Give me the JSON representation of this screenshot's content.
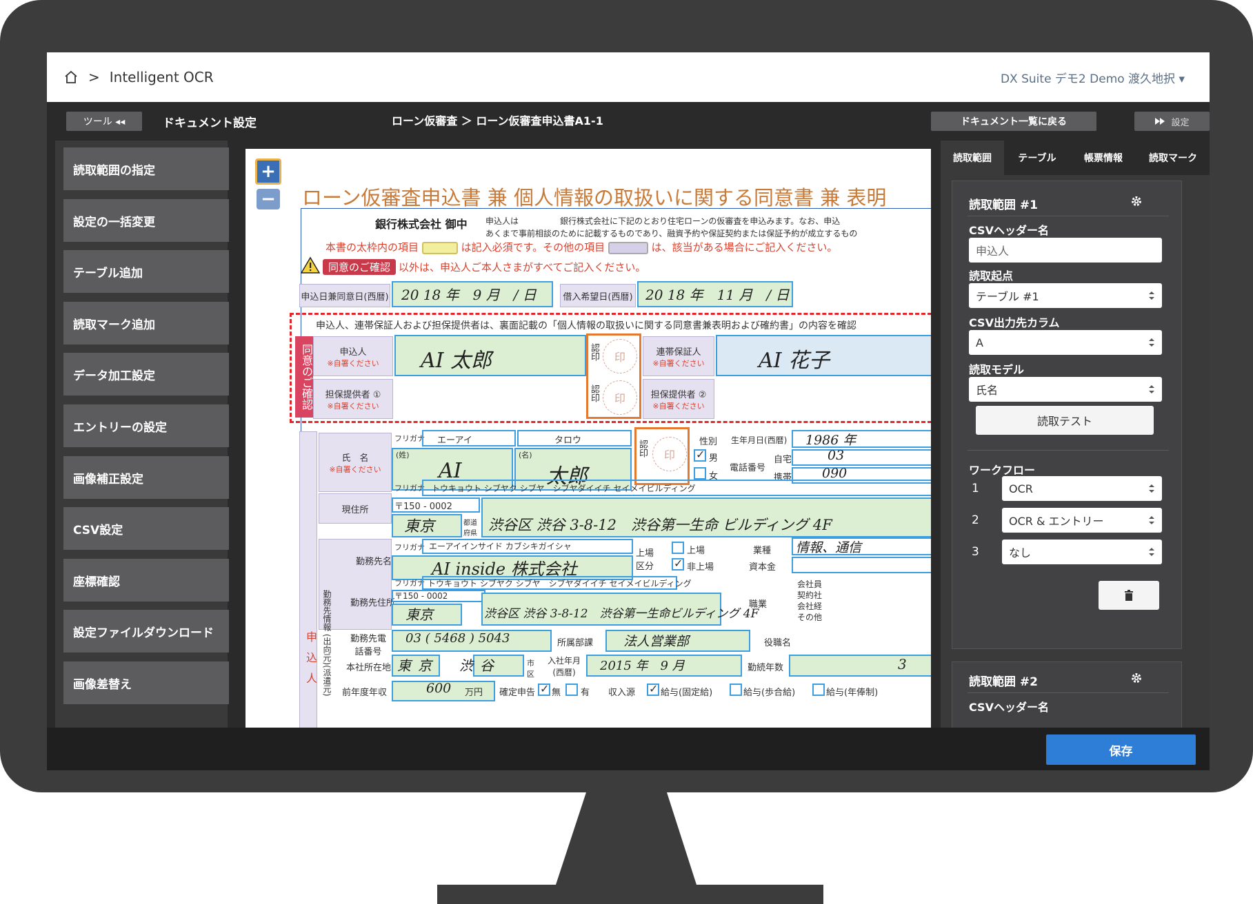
{
  "header": {
    "breadcrumb_sep": ">",
    "app_name": "Intelligent OCR",
    "user": "DX Suite デモ2 Demo 渡久地択 ▾"
  },
  "subbar": {
    "tool_label": "ツール ◂◂",
    "document_settings": "ドキュメント設定",
    "breadcrumb": "ローン仮審査 ＞ ローン仮審査申込書A1-1",
    "back_label": "ドキュメント一覧に戻る",
    "settings_label": "設定"
  },
  "sidebar": {
    "items": [
      {
        "label": "読取範囲の指定"
      },
      {
        "label": "設定の一括変更"
      },
      {
        "label": "テーブル追加"
      },
      {
        "label": "読取マーク追加"
      },
      {
        "label": "データ加工設定"
      },
      {
        "label": "エントリーの設定"
      },
      {
        "label": "画像補正設定"
      },
      {
        "label": "CSV設定"
      },
      {
        "label": "座標確認"
      },
      {
        "label": "設定ファイルダウンロード"
      },
      {
        "label": "画像差替え"
      }
    ]
  },
  "viewer": {
    "zoom_in": "+",
    "zoom_out": "−",
    "title": "ローン仮審査申込書 兼 個人情報の取扱いに関する同意書 兼 表明",
    "bank": "銀行株式会社 御中",
    "applicant_note_1": "申込人は　　　　　銀行株式会社に下記のとおり住宅ローンの仮審査を申込みます。なお、申込",
    "applicant_note_2": "あくまで事前相談のために記載するものであり、融資予約や保証契約または保証予約が成立するもの",
    "warn_a": "本書の太枠内の項目",
    "warn_b": "は記入必須です。その他の項目",
    "warn_c": "は、該当がある場合にご記入ください。",
    "consent_tag": "同意のご確認",
    "consent_note": "以外は、申込人ご本人さまがすべてご記入ください。",
    "date_label": "申込日兼同意日(西暦)",
    "date_value": "20 18 年　9 月　/ 日",
    "loan_date_label": "借入希望日(西暦)",
    "loan_date_value": "20 18 年　11 月　/ 日",
    "consent_banner": "申込人、連帯保証人および担保提供者は、裏面記載の「個人情報の取扱いに関する同意書兼表明および確約書」の内容を確認",
    "consent_side": "同意のご確認",
    "applicant": "申込人",
    "self_write": "※自署ください",
    "applicant_sign": "AI 太郎",
    "seal": "認印",
    "stamp": "印",
    "guarantor": "連帯保証人",
    "guarantor_sign": "AI 花子",
    "collateral1": "担保提供者 ①",
    "collateral2": "担保提供者 ②",
    "furigana": "フリガナ",
    "furigana_last": "エーアイ",
    "furigana_first": "タロウ",
    "name_label": "氏　名",
    "sei": "(姓)",
    "mei": "(名)",
    "name_last": "AI",
    "name_first": "太郎",
    "gender": "性別",
    "male": "男",
    "female": "女",
    "dob": "生年月日(西暦)",
    "dob_value": "1986 年",
    "phone": "電話番号",
    "home": "自宅",
    "mobile": "携帯",
    "phone_home": "03",
    "phone_mobile": "090",
    "address_furigana": "トウキョウト シブヤク シブヤ　シブヤダイイチ セイメイビルディング",
    "address": "現住所",
    "zip": "〒150 - 0002",
    "pref": "東京",
    "pref_suffix": "都道府県",
    "address_value": "渋谷区 渋谷 3-8-12　渋谷第一生命 ビルディング 4F",
    "employer": "勤務先名",
    "employer_furigana": "エーアイインサイド カブシキガイシャ",
    "employer_value": "AI inside 株式会社",
    "listed": "上場区分",
    "listed_yes": "上場",
    "listed_no": "非上場",
    "industry": "業種",
    "industry_value": "情報、通信",
    "capital": "資本金",
    "work_address": "勤務先住所",
    "work_address_value": "渋谷区 渋谷 3-8-12　渋谷第一生命ビルディング 4F",
    "work_side": "勤務先情報 (出向元)(派遣元)",
    "occupation": "職業",
    "occ_opts": [
      "会社員",
      "契約社",
      "会社経",
      "その他"
    ],
    "work_phone": "勤務先電話番号",
    "work_phone_value": "03 ( 5468 ) 5043",
    "dept": "所属部課",
    "dept_value": "法人営業部",
    "position": "役職名",
    "hq": "本社所在地",
    "hq_value": "東京　渋谷",
    "hq_suffix": "市区",
    "join": "入社年月(西暦)",
    "join_value": "2015 年　9 月",
    "tenure": "勤続年数",
    "tenure_value": "3",
    "income": "前年度年収",
    "income_value": "600",
    "income_unit": "万円",
    "tax": "確定申告",
    "tax_no": "無",
    "tax_yes": "有",
    "source": "収入源",
    "src1": "給与(固定給)",
    "src2": "給与(歩合給)",
    "src3": "給与(年俸制)",
    "applicant_side": "申込人"
  },
  "right_panel": {
    "tabs": [
      "読取範囲",
      "テーブル",
      "帳票情報",
      "読取マーク"
    ],
    "card1": {
      "title": "読取範囲 #1",
      "csv_header_label": "CSVヘッダー名",
      "csv_header_value": "申込人",
      "origin_label": "読取起点",
      "origin_value": "テーブル #1",
      "column_label": "CSV出力先カラム",
      "column_value": "A",
      "model_label": "読取モデル",
      "model_value": "氏名",
      "test_button": "読取テスト",
      "workflow_label": "ワークフロー",
      "workflow": [
        {
          "num": "1",
          "value": "OCR"
        },
        {
          "num": "2",
          "value": "OCR & エントリー"
        },
        {
          "num": "3",
          "value": "なし"
        }
      ]
    },
    "card2": {
      "title": "読取範囲 #2",
      "csv_header_label": "CSVヘッダー名"
    }
  },
  "footer": {
    "save": "保存"
  },
  "colors": {
    "accent": "#2e7dd6",
    "frame": "#3c9de0",
    "alert": "#d9412f",
    "monitor": "#3c3c3d"
  }
}
